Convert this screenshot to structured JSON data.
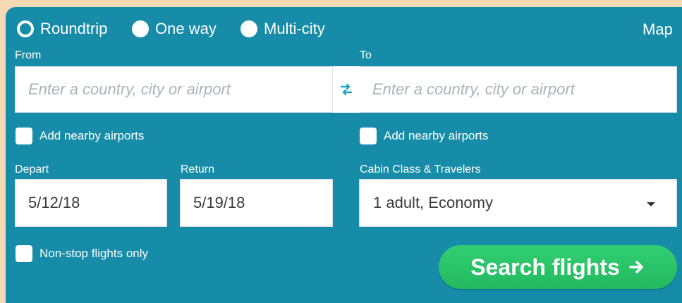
{
  "colors": {
    "background": "#f5d9b4",
    "panel": "#178ca8",
    "search_button": "#2ac768",
    "swap_icon": "#1aa6c4"
  },
  "trip_type": {
    "options": [
      {
        "label": "Roundtrip",
        "selected": true
      },
      {
        "label": "One way",
        "selected": false
      },
      {
        "label": "Multi-city",
        "selected": false
      }
    ],
    "map_label": "Map"
  },
  "from": {
    "label": "From",
    "placeholder": "Enter a country, city or airport",
    "nearby_label": "Add nearby airports"
  },
  "to": {
    "label": "To",
    "placeholder": "Enter a country, city or airport",
    "nearby_label": "Add nearby airports"
  },
  "swap_icon": "swap-arrows-icon",
  "depart": {
    "label": "Depart",
    "value": "5/12/18"
  },
  "return": {
    "label": "Return",
    "value": "5/19/18"
  },
  "cabin": {
    "label": "Cabin Class & Travelers",
    "value": "1 adult, Economy",
    "icon": "caret-down-icon"
  },
  "nonstop": {
    "label": "Non-stop flights only"
  },
  "search": {
    "label": "Search flights",
    "icon": "arrow-right-icon"
  }
}
